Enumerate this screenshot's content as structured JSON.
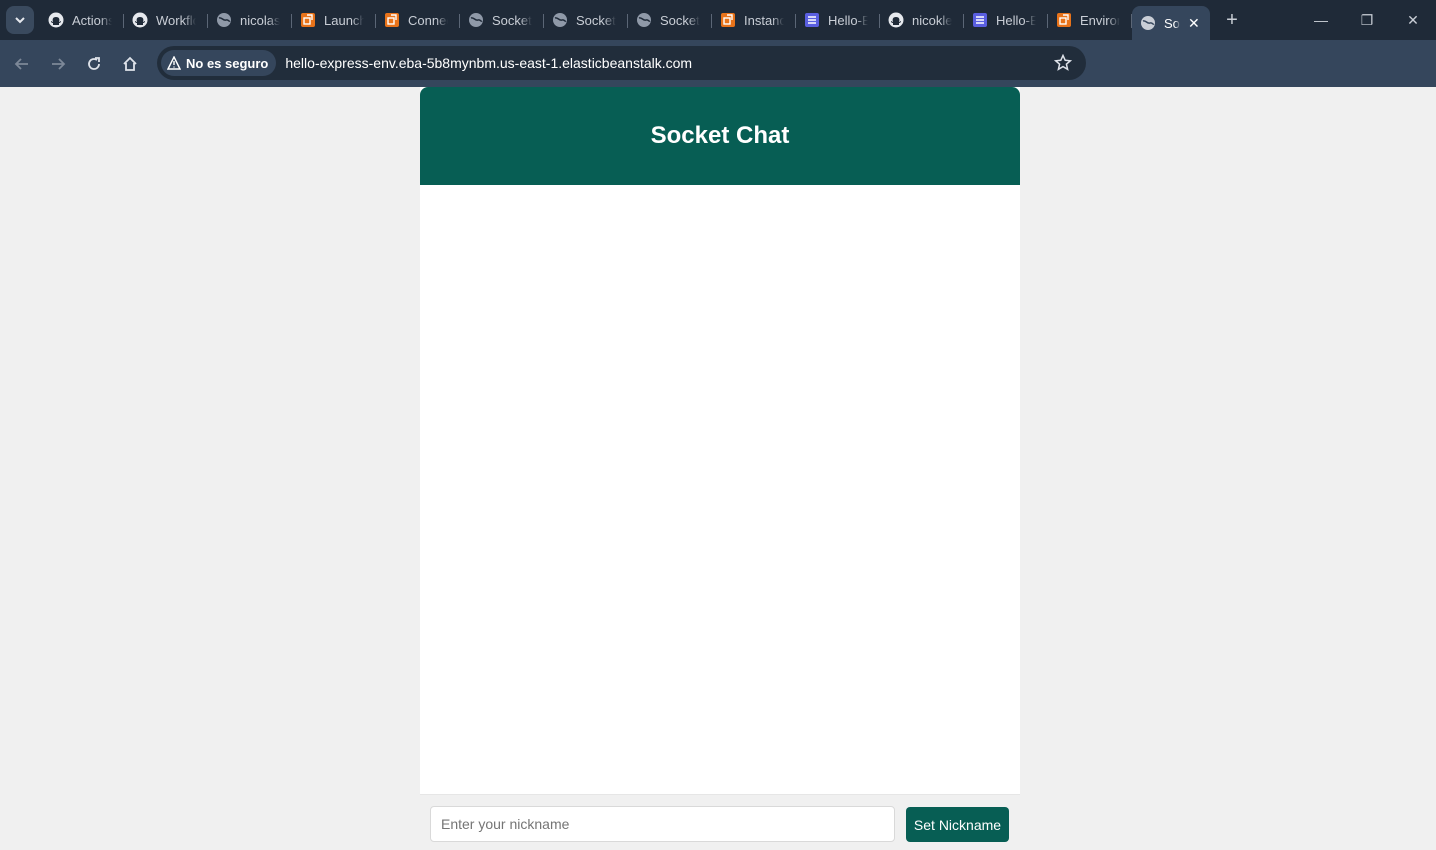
{
  "browser": {
    "tabs": [
      {
        "label": "Actions",
        "icon": "github-icon"
      },
      {
        "label": "Workflows",
        "icon": "github-icon"
      },
      {
        "label": "nicolas",
        "icon": "globe-icon"
      },
      {
        "label": "Launch",
        "icon": "aws-icon"
      },
      {
        "label": "Connect",
        "icon": "aws-icon"
      },
      {
        "label": "Socket",
        "icon": "globe-icon"
      },
      {
        "label": "Socket",
        "icon": "globe-icon"
      },
      {
        "label": "Socket",
        "icon": "globe-icon"
      },
      {
        "label": "Instance",
        "icon": "aws-icon"
      },
      {
        "label": "Hello-E",
        "icon": "storage-icon"
      },
      {
        "label": "nicokle",
        "icon": "github-icon"
      },
      {
        "label": "Hello-E",
        "icon": "storage-icon"
      },
      {
        "label": "Environ",
        "icon": "aws-icon"
      }
    ],
    "active_tab": {
      "label": "Socket Chat",
      "icon": "globe-icon"
    },
    "security_chip": "No es seguro",
    "url": "hello-express-env.eba-5b8mynbm.us-east-1.elasticbeanstalk.com",
    "colors": {
      "tabstrip": "#1f2a38",
      "toolbar": "#35465c",
      "omnibox": "#212d3b"
    }
  },
  "app": {
    "title": "Socket Chat",
    "nickname_placeholder": "Enter your nickname",
    "nickname_value": "",
    "set_nickname_label": "Set Nickname",
    "colors": {
      "header": "#075e54",
      "button": "#075e54"
    }
  }
}
